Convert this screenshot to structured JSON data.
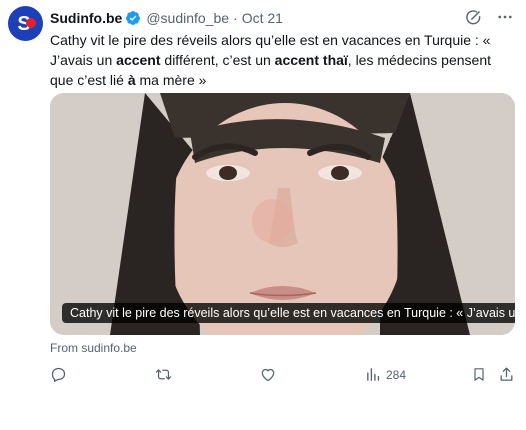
{
  "account": {
    "name": "Sudinfo.be",
    "handle": "@sudinfo_be",
    "separator": "·",
    "date": "Oct 21"
  },
  "tweet": {
    "p1": "Cathy vit le pire des réveils alors qu’elle est en vacances en Turquie : « J’avais un ",
    "b1": "accent",
    "p2": " différent, c’est un ",
    "b2": "accent thaï",
    "p3": ", les médecins pensent que c’est lié ",
    "b3": "à",
    "p4": " ma mère »"
  },
  "media": {
    "caption": "Cathy vit le pire des réveils alors qu’elle est en vacances en Turquie : « J’avais un ..."
  },
  "link_source": "From sudinfo.be",
  "actions": {
    "views": "284"
  },
  "colors": {
    "avatar": "#1d3fb8",
    "avatar_dot": "#e3212a",
    "verified": "#1d9bf0",
    "muted": "#536471"
  },
  "icons": [
    "verified-icon",
    "grok-icon",
    "more-icon",
    "reply-icon",
    "retweet-icon",
    "like-icon",
    "views-icon",
    "bookmark-icon",
    "share-icon"
  ]
}
